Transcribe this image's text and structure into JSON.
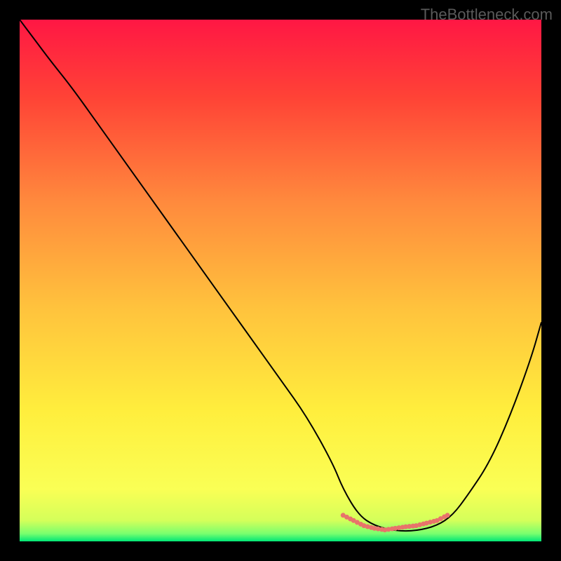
{
  "watermark": "TheBottleneck.com",
  "chart_data": {
    "type": "line",
    "title": "",
    "xlabel": "",
    "ylabel": "",
    "xlim": [
      0,
      100
    ],
    "ylim": [
      0,
      100
    ],
    "background_gradient": {
      "stops": [
        {
          "offset": 0,
          "color": "#ff1744"
        },
        {
          "offset": 0.15,
          "color": "#ff4336"
        },
        {
          "offset": 0.35,
          "color": "#ff8a3d"
        },
        {
          "offset": 0.55,
          "color": "#ffc23d"
        },
        {
          "offset": 0.75,
          "color": "#ffee3d"
        },
        {
          "offset": 0.9,
          "color": "#faff55"
        },
        {
          "offset": 0.96,
          "color": "#d4ff5a"
        },
        {
          "offset": 0.985,
          "color": "#7aff6e"
        },
        {
          "offset": 1.0,
          "color": "#00e676"
        }
      ]
    },
    "series": [
      {
        "name": "bottleneck-curve",
        "color": "#000000",
        "x": [
          0,
          3,
          6,
          10,
          15,
          20,
          25,
          30,
          35,
          40,
          45,
          50,
          55,
          60,
          62,
          65,
          68,
          72,
          76,
          80,
          83,
          86,
          90,
          94,
          98,
          100
        ],
        "y": [
          100,
          96,
          92,
          87,
          80,
          73,
          66,
          59,
          52,
          45,
          38,
          31,
          24,
          15,
          10,
          5,
          3,
          2,
          2,
          3,
          5,
          9,
          15,
          24,
          35,
          42
        ]
      },
      {
        "name": "optimal-range-marker",
        "color": "#e8736b",
        "type": "dotted",
        "x": [
          62,
          64,
          66,
          68,
          70,
          72,
          74,
          76,
          78,
          80,
          82
        ],
        "y": [
          5,
          4,
          3,
          2.5,
          2.2,
          2.5,
          2.8,
          3,
          3.5,
          4,
          5
        ]
      }
    ]
  }
}
